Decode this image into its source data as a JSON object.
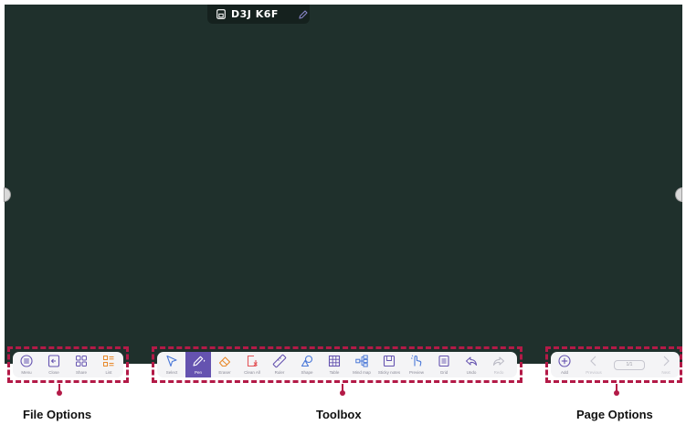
{
  "board": {
    "title": "D3J K6F",
    "background": "#1f302c"
  },
  "accent": "#6553b0",
  "highlight": "#b31a47",
  "file_options": {
    "callout": "File Options",
    "items": [
      {
        "label": "Menu",
        "icon": "menu-icon"
      },
      {
        "label": "Close",
        "icon": "close-file-icon"
      },
      {
        "label": "Share",
        "icon": "share-icon"
      },
      {
        "label": "List",
        "icon": "list-icon"
      }
    ]
  },
  "toolbox": {
    "callout": "Toolbox",
    "items": [
      {
        "label": "Select",
        "icon": "select-icon"
      },
      {
        "label": "Pen",
        "icon": "pen-icon",
        "active": true
      },
      {
        "label": "Eraser",
        "icon": "eraser-icon"
      },
      {
        "label": "Clean All",
        "icon": "clean-all-icon"
      },
      {
        "label": "Ruler",
        "icon": "ruler-icon"
      },
      {
        "label": "Shape",
        "icon": "shape-icon"
      },
      {
        "label": "Table",
        "icon": "table-icon"
      },
      {
        "label": "Mind map",
        "icon": "mind-map-icon"
      },
      {
        "label": "Sticky notes",
        "icon": "sticky-notes-icon"
      },
      {
        "label": "Preview",
        "icon": "preview-icon"
      },
      {
        "label": "Grid",
        "icon": "grid-icon"
      },
      {
        "label": "Undo",
        "icon": "undo-icon"
      },
      {
        "label": "Redo",
        "icon": "redo-icon",
        "disabled": true
      }
    ]
  },
  "page_options": {
    "callout": "Page Options",
    "add_label": "Add",
    "previous_label": "Previous",
    "counter": "1/1",
    "next_label": "Next"
  }
}
